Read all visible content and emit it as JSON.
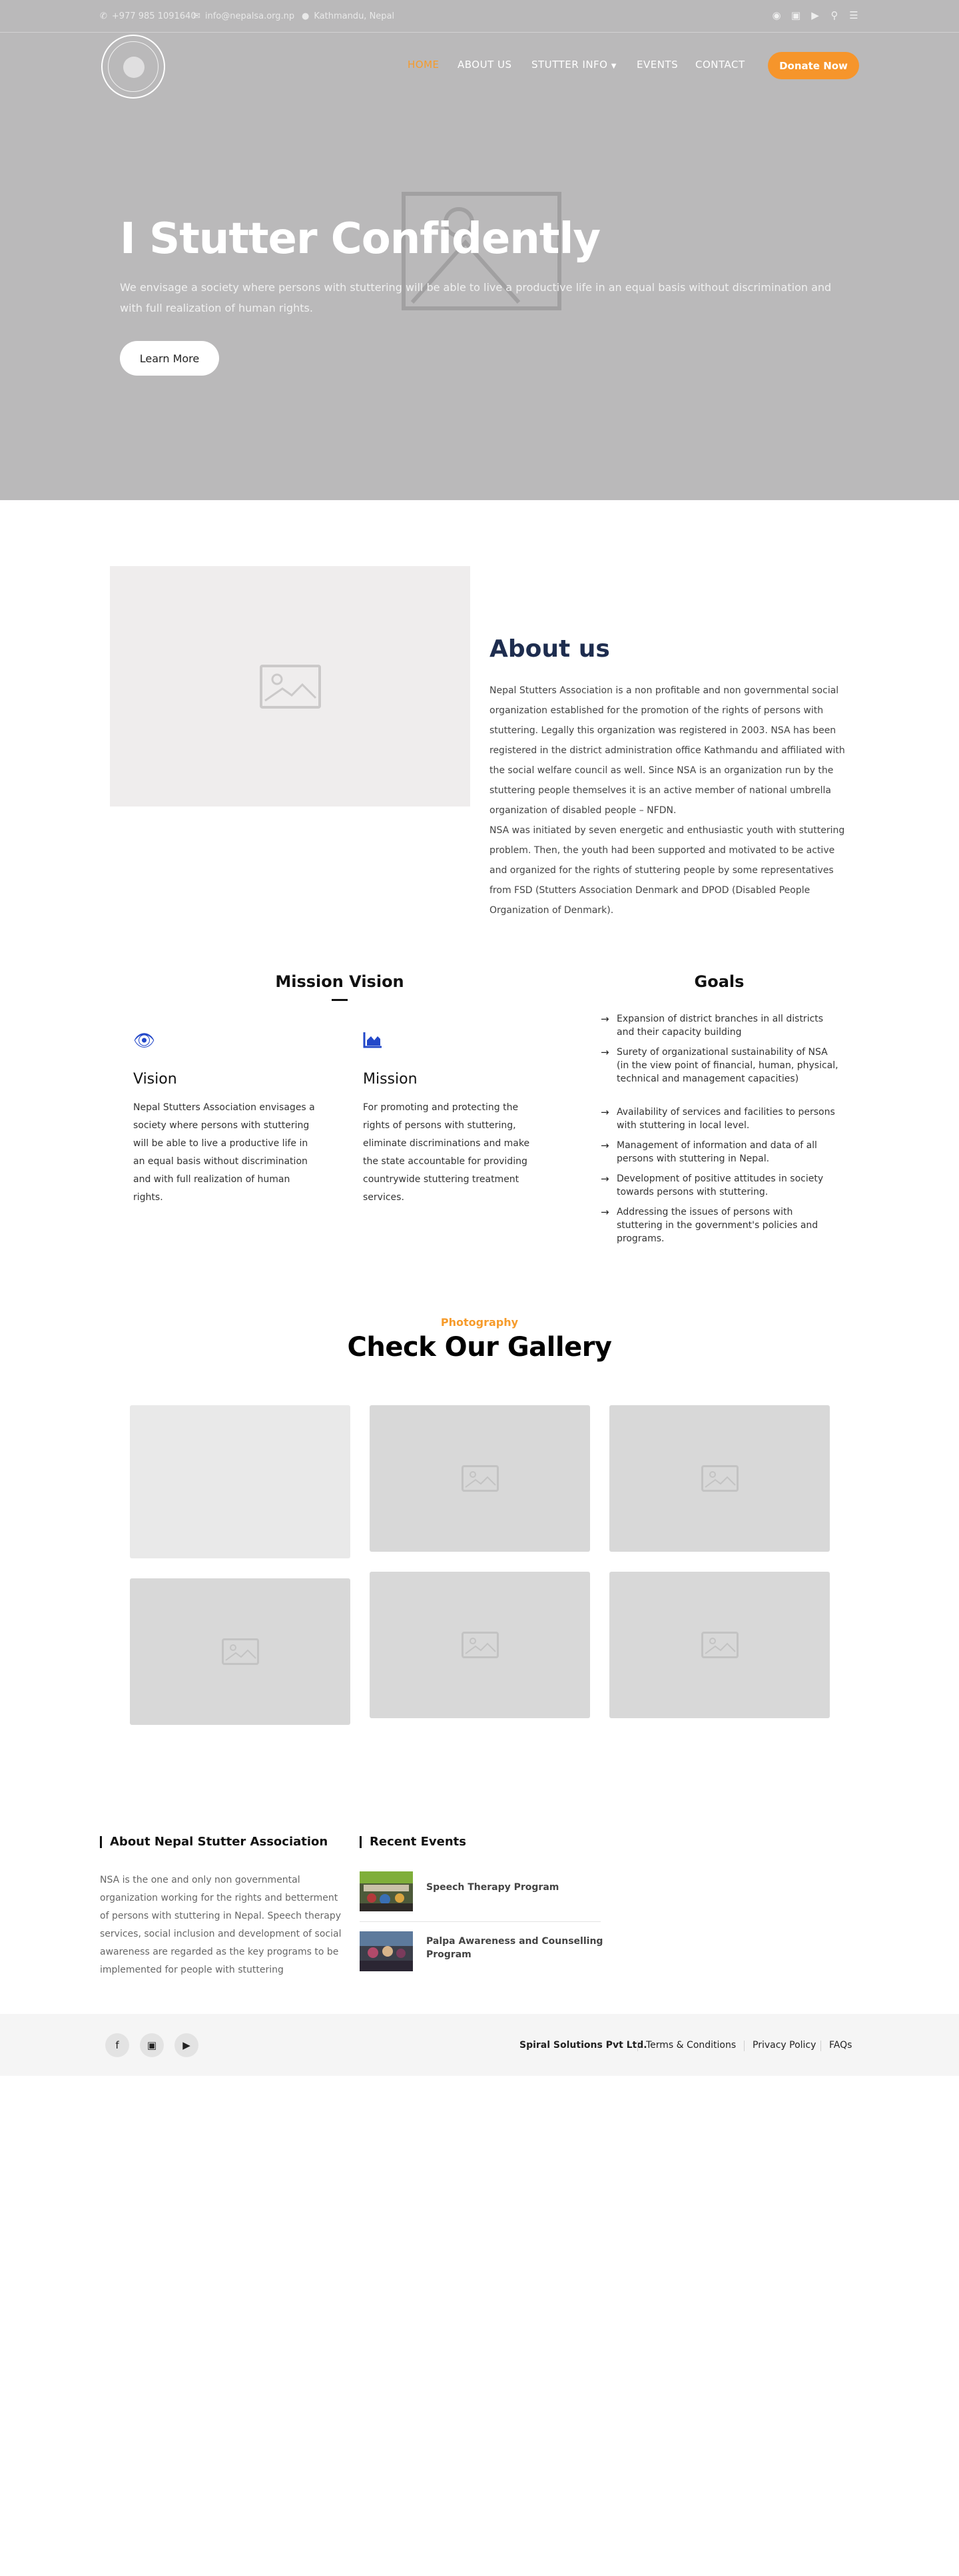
{
  "topbar": {
    "phone": "+977 985 1091640",
    "email": "info@nepalsa.org.np",
    "location": "Kathmandu, Nepal",
    "social_icons": [
      "facebook-icon",
      "instagram-icon",
      "youtube-icon",
      "search-icon",
      "menu-icon"
    ]
  },
  "nav": {
    "items": [
      "HOME",
      "ABOUT US",
      "STUTTER INFO",
      "EVENTS",
      "CONTACT"
    ],
    "active_color": "#f69b2b",
    "donate": "Donate Now",
    "donate_color": "#f6952b"
  },
  "hero": {
    "title": "I Stutter Confidently",
    "subtitle": "We envisage a society where persons with stuttering will be able to live a productive life in an equal basis without discrimination and with full realization of human rights.",
    "cta": "Learn More"
  },
  "about": {
    "title": "About us",
    "paragraph1": "Nepal Stutters Association is a non profitable and non governmental social organization established for the promotion of the rights of persons with stuttering. Legally this organization was registered in 2003. NSA has been registered in the district administration office Kathmandu and affiliated with the social welfare council as well. Since NSA is an organization run by the stuttering people themselves it is an active member of national umbrella organization of disabled people – NFDN.",
    "paragraph2": "NSA was initiated by seven energetic and enthusiastic youth with stuttering problem. Then, the youth had been supported and motivated to be active and organized for the rights of stuttering people by some representatives from FSD (Stutters Association Denmark and DPOD (Disabled People Organization of Denmark)."
  },
  "mission_vision": {
    "heading": "Mission Vision",
    "vision_title": "Vision",
    "vision_text": "Nepal Stutters Association envisages a society where persons with stuttering will be able to live a productive life in an equal basis without discrimination and with full realization of human rights.",
    "mission_title": "Mission",
    "mission_text": "For promoting and protecting the rights of persons with stuttering, eliminate discriminations and make the state accountable for providing countrywide stuttering treatment services.",
    "icon_color": "#2348c9"
  },
  "goals": {
    "heading": "Goals",
    "items": [
      "Expansion of district branches in all districts and their capacity building",
      "Surety of organizational sustainability of NSA (in the view point of financial, human, physical, technical and management capacities)",
      "Availability of services and facilities to persons with stuttering in local level.",
      "Management of information and data of all persons with stuttering in Nepal.",
      "Development of positive attitudes in society towards persons with stuttering.",
      "Addressing the issues of persons with stuttering in the government's policies and programs."
    ]
  },
  "gallery": {
    "kicker": "Photography",
    "title": "Check Our Gallery"
  },
  "footer": {
    "about_heading": "About Nepal Stutter Association",
    "about_text": "NSA is the one and only non governmental organization working for the rights and betterment of persons with stuttering in Nepal. Speech therapy services, social inclusion and development of social awareness are regarded as the key programs to be implemented for people with stuttering",
    "events_heading": "Recent Events",
    "events": [
      "Speech Therapy Program",
      "Palpa Awareness and Counselling Program"
    ],
    "company": "Spiral Solutions Pvt Ltd.",
    "links": [
      "Terms & Conditions",
      "Privacy Policy",
      "FAQs"
    ]
  }
}
